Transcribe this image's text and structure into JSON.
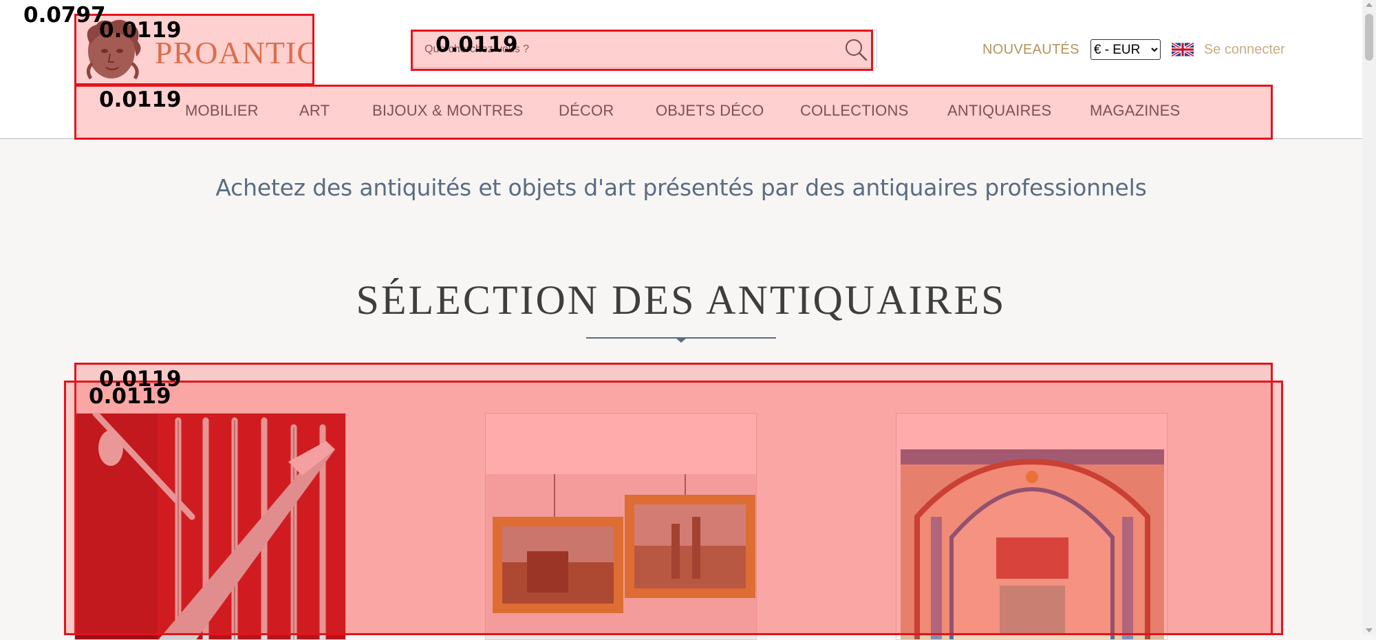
{
  "overlay_scores": {
    "page": "0.0797",
    "logo": "0.0119",
    "search": "0.0119",
    "nav": "0.0119",
    "selection_grid": "0.0119",
    "selection_cards": "0.0119"
  },
  "header": {
    "logo_text": "PROANTIC",
    "search_placeholder": "Que cherchez-vous ?",
    "nouveautes": "NOUVEAUTÉS",
    "currency_selected": "€ - EUR",
    "language_icon": "uk-flag-icon",
    "login": "Se connecter"
  },
  "nav": {
    "items": [
      "MOBILIER",
      "ART",
      "BIJOUX & MONTRES",
      "DÉCOR",
      "OBJETS DÉCO",
      "COLLECTIONS",
      "ANTIQUAIRES",
      "MAGAZINES"
    ]
  },
  "main": {
    "tagline": "Achetez des antiquités et objets d'art présentés par des antiquaires professionnels",
    "section_title": "SÉLECTION DES ANTIQUAIRES",
    "cards": [
      {
        "subject": "silver cutlery set in red case"
      },
      {
        "subject": "two gilt-framed landscape paintings"
      },
      {
        "subject": "embroidered textile panel with arches"
      }
    ]
  },
  "colors": {
    "logo": "#d38257",
    "nouveautes": "#b3935a",
    "login": "#c8ab80",
    "tagline": "#5a6b82",
    "highlight": "#e3141c"
  }
}
